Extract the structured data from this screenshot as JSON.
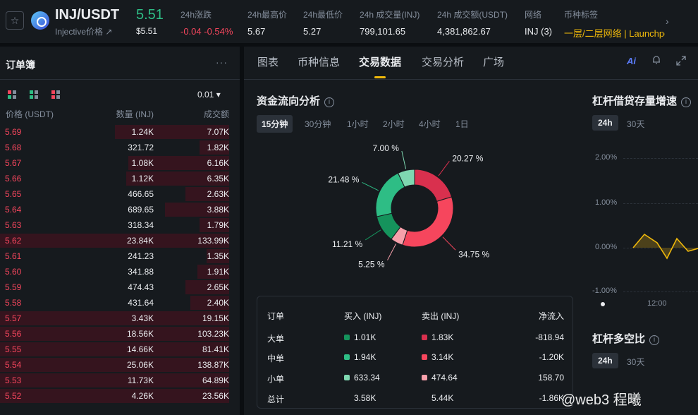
{
  "header": {
    "pair": "INJ/USDT",
    "pair_sub": "Injective价格 ↗",
    "last_price": "5.51",
    "last_price_usd": "$5.51",
    "stats": [
      {
        "label": "24h涨跌",
        "value": "-0.04 -0.54%",
        "color": "red"
      },
      {
        "label": "24h最高价",
        "value": "5.67",
        "color": "white"
      },
      {
        "label": "24h最低价",
        "value": "5.27",
        "color": "white"
      },
      {
        "label": "24h 成交量(INJ)",
        "value": "799,101.65",
        "color": "white"
      },
      {
        "label": "24h 成交额(USDT)",
        "value": "4,381,862.67",
        "color": "white"
      },
      {
        "label": "网络",
        "value": "INJ (3)",
        "color": "white"
      },
      {
        "label": "币种标签",
        "value": "一层/二层网络 | Launchpool",
        "color": "gold"
      }
    ]
  },
  "orderbook": {
    "title": "订单簿",
    "precision": "0.01 ▾",
    "col_price": "价格 (USDT)",
    "col_qty": "数量 (INJ)",
    "col_total": "成交额",
    "rows": [
      {
        "price": "5.69",
        "qty": "1.24K",
        "total": "7.07K",
        "depth": 0.5
      },
      {
        "price": "5.68",
        "qty": "321.72",
        "total": "1.82K",
        "depth": 0.13
      },
      {
        "price": "5.67",
        "qty": "1.08K",
        "total": "6.16K",
        "depth": 0.44
      },
      {
        "price": "5.66",
        "qty": "1.12K",
        "total": "6.35K",
        "depth": 0.45
      },
      {
        "price": "5.65",
        "qty": "466.65",
        "total": "2.63K",
        "depth": 0.19
      },
      {
        "price": "5.64",
        "qty": "689.65",
        "total": "3.88K",
        "depth": 0.28
      },
      {
        "price": "5.63",
        "qty": "318.34",
        "total": "1.79K",
        "depth": 0.13
      },
      {
        "price": "5.62",
        "qty": "23.84K",
        "total": "133.99K",
        "depth": 1.0
      },
      {
        "price": "5.61",
        "qty": "241.23",
        "total": "1.35K",
        "depth": 0.1
      },
      {
        "price": "5.60",
        "qty": "341.88",
        "total": "1.91K",
        "depth": 0.14
      },
      {
        "price": "5.59",
        "qty": "474.43",
        "total": "2.65K",
        "depth": 0.19
      },
      {
        "price": "5.58",
        "qty": "431.64",
        "total": "2.40K",
        "depth": 0.17
      },
      {
        "price": "5.57",
        "qty": "3.43K",
        "total": "19.15K",
        "depth": 1.0
      },
      {
        "price": "5.56",
        "qty": "18.56K",
        "total": "103.23K",
        "depth": 1.0
      },
      {
        "price": "5.55",
        "qty": "14.66K",
        "total": "81.41K",
        "depth": 1.0
      },
      {
        "price": "5.54",
        "qty": "25.06K",
        "total": "138.87K",
        "depth": 1.0
      },
      {
        "price": "5.53",
        "qty": "11.73K",
        "total": "64.89K",
        "depth": 1.0
      },
      {
        "price": "5.52",
        "qty": "4.26K",
        "total": "23.56K",
        "depth": 1.0
      }
    ]
  },
  "tabs": [
    "图表",
    "币种信息",
    "交易数据",
    "交易分析",
    "广场"
  ],
  "fund_flow": {
    "title": "资金流向分析",
    "periods": [
      "15分钟",
      "30分钟",
      "1小时",
      "2小时",
      "4小时",
      "1日"
    ],
    "active_period": 0,
    "slices": [
      {
        "label": "20.27 %",
        "value": 20.27,
        "color": "#d9304e"
      },
      {
        "label": "34.75 %",
        "value": 34.75,
        "color": "#f6465d"
      },
      {
        "label": "5.25 %",
        "value": 5.25,
        "color": "#f7a0ab"
      },
      {
        "label": "11.21 %",
        "value": 11.21,
        "color": "#15935c"
      },
      {
        "label": "21.48 %",
        "value": 21.48,
        "color": "#2ebd85"
      },
      {
        "label": "7.00 %",
        "value": 7.0,
        "color": "#7fd8b1"
      }
    ],
    "table": {
      "headers": [
        "订单",
        "买入 (INJ)",
        "卖出 (INJ)",
        "净流入"
      ],
      "rows": [
        {
          "name": "大单",
          "buy": "1.01K",
          "sell": "1.83K",
          "net": "-818.94",
          "buy_color": "#15935c",
          "sell_color": "#d9304e"
        },
        {
          "name": "中单",
          "buy": "1.94K",
          "sell": "3.14K",
          "net": "-1.20K",
          "buy_color": "#2ebd85",
          "sell_color": "#f6465d"
        },
        {
          "name": "小单",
          "buy": "633.34",
          "sell": "474.64",
          "net": "158.70",
          "buy_color": "#7fd8b1",
          "sell_color": "#f7a0ab"
        },
        {
          "name": "总计",
          "buy": "3.58K",
          "sell": "5.44K",
          "net": "-1.86K",
          "buy_color": "",
          "sell_color": ""
        }
      ]
    }
  },
  "leverage": {
    "title": "杠杆借贷存量增速",
    "periods": [
      "24h",
      "30天"
    ],
    "y_ticks": [
      "2.00%",
      "1.00%",
      "0.00%",
      "-1.00%"
    ],
    "x_tick": "12:00",
    "ratio_title": "杠杆多空比",
    "ratio_periods": [
      "24h",
      "30天"
    ]
  },
  "watermark": "@web3  程曦",
  "chart_data": {
    "type": "pie",
    "title": "资金流向分析",
    "categories": [
      "大单卖出",
      "中单卖出",
      "小单卖出",
      "小单买入",
      "中单买入",
      "大单买入"
    ],
    "values": [
      20.27,
      34.75,
      5.25,
      11.21,
      21.48,
      7.0
    ],
    "labels": [
      "20.27 %",
      "34.75 %",
      "5.25 %",
      "11.21 %",
      "21.48 %",
      "7.00 %"
    ]
  }
}
